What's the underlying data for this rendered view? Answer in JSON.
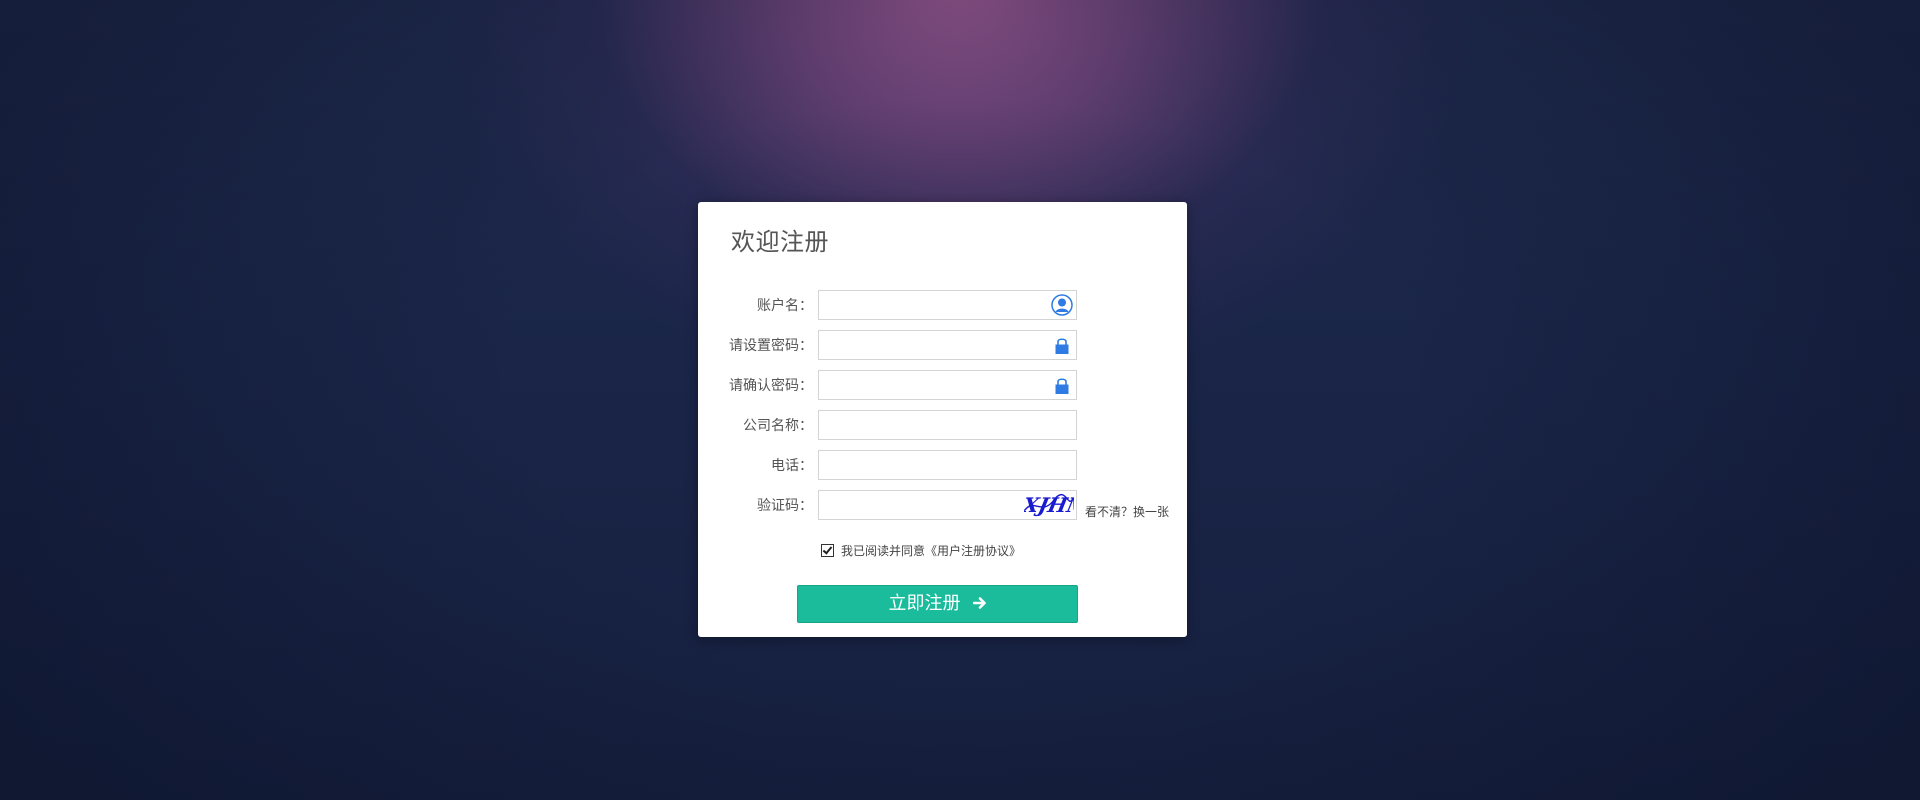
{
  "form": {
    "title": "欢迎注册",
    "fields": [
      {
        "label": "账户名：",
        "value": "",
        "placeholder": "",
        "icon": "user-icon",
        "icon_color": "#2e7be4"
      },
      {
        "label": "请设置密码：",
        "value": "",
        "placeholder": "",
        "icon": "lock-icon",
        "icon_color": "#2e7be4"
      },
      {
        "label": "请确认密码：",
        "value": "",
        "placeholder": "",
        "icon": "lock-icon",
        "icon_color": "#2e7be4"
      },
      {
        "label": "公司名称：",
        "value": "",
        "placeholder": ""
      },
      {
        "label": "电话：",
        "value": "",
        "placeholder": ""
      },
      {
        "label": "验证码：",
        "value": "",
        "placeholder": "",
        "captcha_text": "XJHM"
      }
    ],
    "captcha_refresh": "看不清？换一张",
    "agreement": {
      "checked": true,
      "text": "我已阅读并同意《用户注册协议》"
    },
    "submit_label": "立即注册",
    "accent_color": "#1abc9c"
  }
}
